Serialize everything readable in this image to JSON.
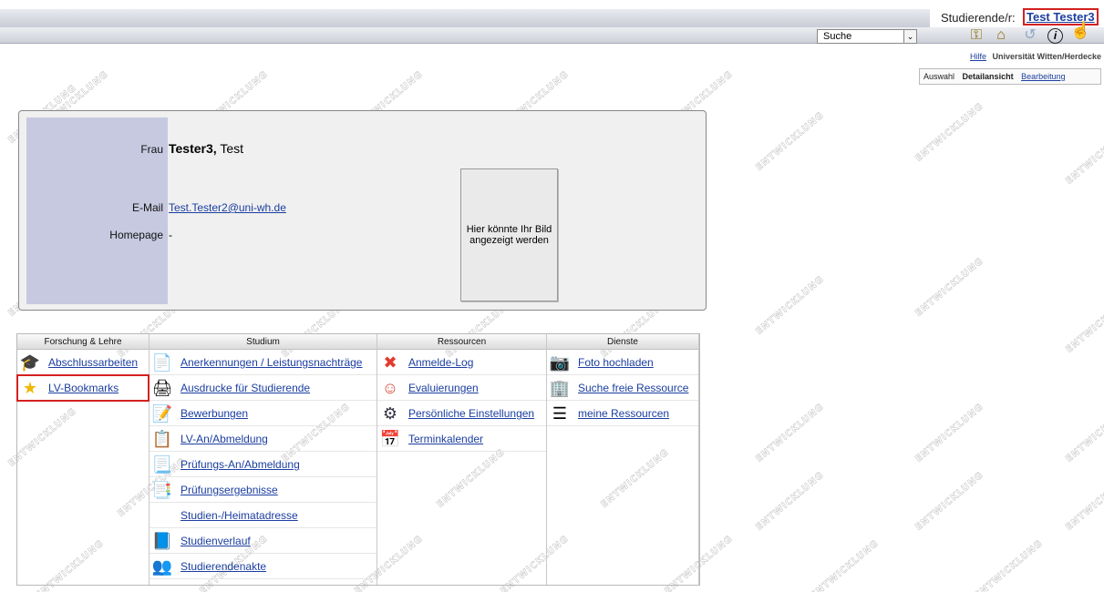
{
  "header": {
    "user_label": "Studierende/r:",
    "user_name": "Test Tester3",
    "search_value": "Suche",
    "help_link": "Hilfe",
    "university": "Universität Witten/Herdecke"
  },
  "toolbar_icons": [
    "key-icon",
    "home-icon",
    "refresh-icon",
    "info-icon",
    "hand-pointer-icon"
  ],
  "view_tabs": {
    "auswahl": "Auswahl",
    "detail": "Detailansicht",
    "edit": "Bearbeitung"
  },
  "watermark": "ENTWICKLUNG",
  "profile": {
    "salutation": "Frau",
    "last_name": "Tester3,",
    "first_name": "Test",
    "email_label": "E-Mail",
    "email": "Test.Tester2@uni-wh.de",
    "homepage_label": "Homepage",
    "homepage": "-",
    "photo_placeholder": "Hier könnte Ihr Bild angezeigt werden"
  },
  "services": [
    {
      "title": "Forschung & Lehre",
      "items": [
        {
          "label": "Abschlussarbeiten",
          "icon": "graduation-cap-icon"
        },
        {
          "label": "LV-Bookmarks",
          "icon": "star-icon"
        }
      ]
    },
    {
      "title": "Studium",
      "items": [
        {
          "label": "Anerkennungen / Leistungsnachträge",
          "icon": "document-icon"
        },
        {
          "label": "Ausdrucke für Studierende",
          "icon": "printer-icon"
        },
        {
          "label": "Bewerbungen",
          "icon": "application-doc-icon"
        },
        {
          "label": "LV-An/Abmeldung",
          "icon": "board-icon"
        },
        {
          "label": "Prüfungs-An/Abmeldung",
          "icon": "exam-doc-icon"
        },
        {
          "label": "Prüfungsergebnisse",
          "icon": "results-doc-icon"
        },
        {
          "label": "Studien-/Heimatadresse",
          "icon": ""
        },
        {
          "label": "Studienverlauf",
          "icon": "progress-book-icon"
        },
        {
          "label": "Studierendenakte",
          "icon": "people-icon"
        }
      ]
    },
    {
      "title": "Ressourcen",
      "items": [
        {
          "label": "Anmelde-Log",
          "icon": "error-circle-icon"
        },
        {
          "label": "Evaluierungen",
          "icon": "smileys-icon"
        },
        {
          "label": "Persönliche Einstellungen",
          "icon": "gears-icon"
        },
        {
          "label": "Terminkalender",
          "icon": "calendar-icon"
        }
      ]
    },
    {
      "title": "Dienste",
      "items": [
        {
          "label": "Foto hochladen",
          "icon": "camera-icon"
        },
        {
          "label": "Suche freie Ressource",
          "icon": "building-search-icon"
        },
        {
          "label": "meine Ressourcen",
          "icon": "list-icon"
        }
      ]
    }
  ]
}
